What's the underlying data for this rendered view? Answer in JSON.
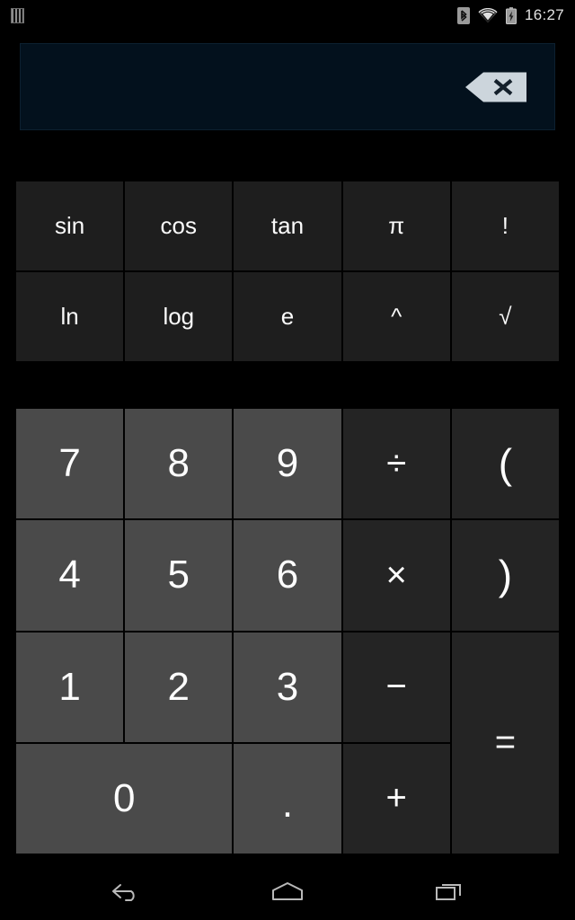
{
  "status_bar": {
    "notification_icon": "app-bars-icon",
    "bluetooth_icon": "bluetooth-icon",
    "wifi_icon": "wifi-icon",
    "battery_icon": "battery-charging-icon",
    "clock": "16:27"
  },
  "display": {
    "value": "",
    "placeholder": "",
    "background_color": "#03111d",
    "backspace_icon": "backspace-delete-icon",
    "backspace_fill": "#ccd5dc"
  },
  "function_pad": {
    "keys": [
      {
        "label": "sin",
        "name": "sin-key"
      },
      {
        "label": "cos",
        "name": "cos-key"
      },
      {
        "label": "tan",
        "name": "tan-key"
      },
      {
        "label": "π",
        "name": "pi-key"
      },
      {
        "label": "!",
        "name": "factorial-key"
      },
      {
        "label": "ln",
        "name": "ln-key"
      },
      {
        "label": "log",
        "name": "log-key"
      },
      {
        "label": "e",
        "name": "euler-key"
      },
      {
        "label": "^",
        "name": "power-key"
      },
      {
        "label": "√",
        "name": "sqrt-key"
      }
    ],
    "background_color": "#1e1e1e"
  },
  "keypad": {
    "keys": [
      {
        "label": "7",
        "name": "digit-7-key",
        "kind": "num"
      },
      {
        "label": "8",
        "name": "digit-8-key",
        "kind": "num"
      },
      {
        "label": "9",
        "name": "digit-9-key",
        "kind": "num"
      },
      {
        "label": "÷",
        "name": "divide-key",
        "kind": "op"
      },
      {
        "label": "(",
        "name": "open-paren-key",
        "kind": "paren"
      },
      {
        "label": "4",
        "name": "digit-4-key",
        "kind": "num"
      },
      {
        "label": "5",
        "name": "digit-5-key",
        "kind": "num"
      },
      {
        "label": "6",
        "name": "digit-6-key",
        "kind": "num"
      },
      {
        "label": "×",
        "name": "multiply-key",
        "kind": "op"
      },
      {
        "label": ")",
        "name": "close-paren-key",
        "kind": "paren"
      },
      {
        "label": "1",
        "name": "digit-1-key",
        "kind": "num"
      },
      {
        "label": "2",
        "name": "digit-2-key",
        "kind": "num"
      },
      {
        "label": "3",
        "name": "digit-3-key",
        "kind": "num"
      },
      {
        "label": "−",
        "name": "minus-key",
        "kind": "op"
      },
      {
        "label": "=",
        "name": "equals-key",
        "kind": "equals"
      },
      {
        "label": "0",
        "name": "digit-0-key",
        "kind": "zero"
      },
      {
        "label": ".",
        "name": "decimal-point-key",
        "kind": "dot"
      },
      {
        "label": "+",
        "name": "plus-key",
        "kind": "op"
      }
    ],
    "number_color": "#4a4a4a",
    "operator_color": "#242424"
  },
  "nav_bar": {
    "back_icon": "back-arrow-icon",
    "home_icon": "home-icon",
    "recents_icon": "recent-apps-icon"
  }
}
